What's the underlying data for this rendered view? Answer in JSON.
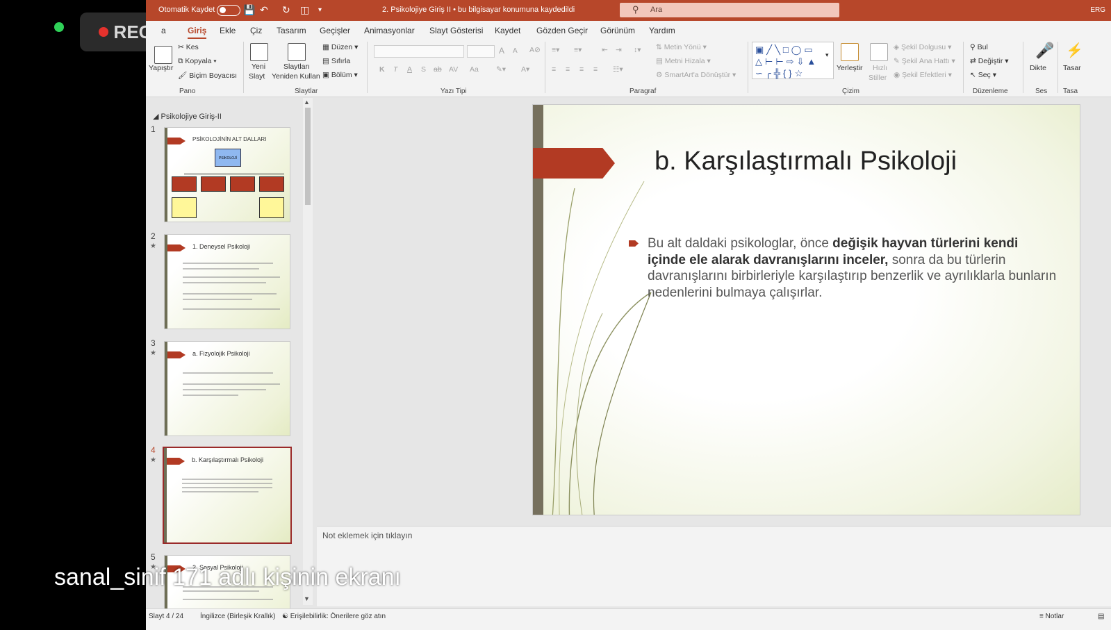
{
  "zoom": {
    "rec_label": "REC",
    "share_label": "sanal_sinif 171 adlı kişinin ekranı"
  },
  "titlebar": {
    "autosave_label": "Otomatik Kaydet",
    "doc_title": "2. Psikolojiye Giriş II  •  bu bilgisayar konumuna kaydedildi",
    "search_placeholder": "Ara",
    "user_initials": "ERG"
  },
  "tabs": [
    "a",
    "Giriş",
    "Ekle",
    "Çiz",
    "Tasarım",
    "Geçişler",
    "Animasyonlar",
    "Slayt Gösterisi",
    "Kaydet",
    "Gözden Geçir",
    "Görünüm",
    "Yardım"
  ],
  "ribbon": {
    "pano": {
      "label": "Pano",
      "paste": "Yapıştır",
      "cut": "Kes",
      "copy": "Kopyala",
      "format_painter": "Biçim Boyacısı"
    },
    "slaytlar": {
      "label": "Slaytlar",
      "new_slide_1": "Yeni",
      "new_slide_2": "Slayt",
      "reuse_1": "Slaytları",
      "reuse_2": "Yeniden Kullan",
      "layout": "Düzen",
      "reset": "Sıfırla",
      "section": "Bölüm"
    },
    "yazi_tipi": {
      "label": "Yazı Tipi",
      "bold": "K",
      "italic": "T",
      "underline": "A",
      "shadow": "S",
      "strike": "ab",
      "spacing": "AV",
      "case": "Aa",
      "grow": "A",
      "shrink": "A"
    },
    "paragraf": {
      "label": "Paragraf",
      "text_direction": "Metin Yönü",
      "align_text": "Metni Hizala",
      "smartart": "SmartArt'a Dönüştür"
    },
    "cizim": {
      "label": "Çizim",
      "arrange": "Yerleştir",
      "quick_styles_1": "Hızlı",
      "quick_styles_2": "Stiller",
      "shape_fill": "Şekil Dolgusu",
      "shape_outline": "Şekil Ana Hattı",
      "shape_effects": "Şekil Efektleri"
    },
    "duzenleme": {
      "label": "Düzenleme",
      "find": "Bul",
      "replace": "Değiştir",
      "select": "Seç"
    },
    "ses": {
      "label": "Ses",
      "dictate": "Dikte"
    },
    "tasarimci": {
      "label": "Tasa",
      "button": "Tasar"
    }
  },
  "thumbnails": {
    "section_title": "Psikolojiye Giriş-II",
    "slides": [
      {
        "num": "1",
        "title": "PSİKOLOJİNİN  ALT DALLARI",
        "root_box": "PSİKOLOJİ"
      },
      {
        "num": "2",
        "title": "1. Deneysel Psikoloji"
      },
      {
        "num": "3",
        "title": "a. Fizyolojik Psikoloji"
      },
      {
        "num": "4",
        "title": "b. Karşılaştırmalı Psikoloji"
      },
      {
        "num": "5",
        "title": "2. Sosyal Psikoloji"
      }
    ]
  },
  "slide": {
    "title": "b. Karşılaştırmalı Psikoloji",
    "body_pre": "Bu alt daldaki psikologlar, önce ",
    "body_bold": "değişik hayvan türlerini kendi içinde ele alarak davranışlarını inceler,",
    "body_post": " sonra da bu türlerin davranışlarını birbirleriyle karşılaştırıp benzerlik ve ayrılıklarla bunların nedenlerini bulmaya çalışırlar."
  },
  "notes_placeholder": "Not eklemek için tıklayın",
  "status": {
    "slide_counter": "Slayt 4 / 24",
    "language": "İngilizce (Birleşik Krallık)",
    "accessibility": "Erişilebilirlik: Önerilere göz atın",
    "notes": "Notlar"
  },
  "colors": {
    "accent": "#b7472a",
    "slide_arrow": "#b23a23",
    "slide_bar": "#76705d"
  }
}
